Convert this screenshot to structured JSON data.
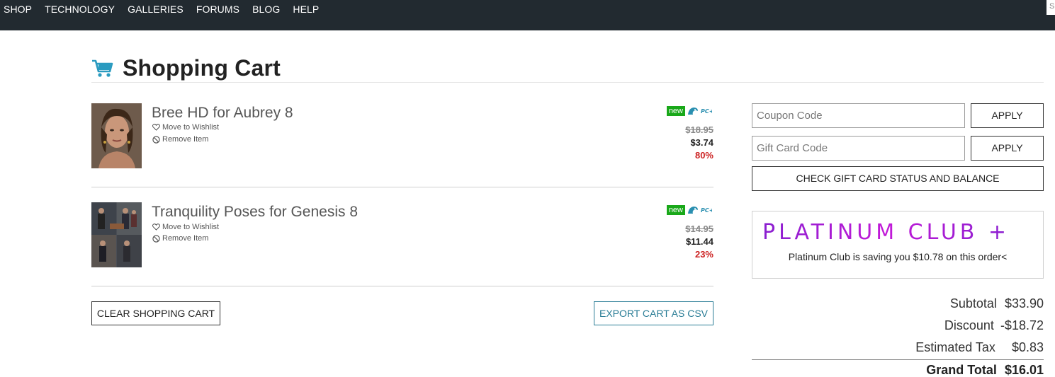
{
  "nav": {
    "items": [
      "SHOP",
      "TECHNOLOGY",
      "GALLERIES",
      "FORUMS",
      "BLOG",
      "HELP"
    ],
    "search_partial": "S"
  },
  "page": {
    "title": "Shopping Cart",
    "cart_icon": "shopping-cart-icon",
    "accent_color": "#2a9bc0"
  },
  "items": [
    {
      "name": "Bree HD for Aubrey 8",
      "wishlist_label": "Move to Wishlist",
      "remove_label": "Remove Item",
      "badge_new": "new",
      "badge_icons": [
        "daz-icon",
        "daz-plus-icon"
      ],
      "old_price": "$18.95",
      "new_price": "$3.74",
      "discount": "80%"
    },
    {
      "name": "Tranquility Poses for Genesis 8",
      "wishlist_label": "Move to Wishlist",
      "remove_label": "Remove Item",
      "badge_new": "new",
      "badge_icons": [
        "daz-icon",
        "daz-plus-icon"
      ],
      "old_price": "$14.95",
      "new_price": "$11.44",
      "discount": "23%"
    }
  ],
  "actions": {
    "clear_cart": "CLEAR SHOPPING CART",
    "export_csv": "EXPORT CART AS CSV"
  },
  "sidebar": {
    "coupon_placeholder": "Coupon Code",
    "gift_placeholder": "Gift Card Code",
    "apply_label": "APPLY",
    "check_gift_label": "CHECK GIFT CARD STATUS AND BALANCE",
    "platinum_logo": "PLATINUM CLUB +",
    "platinum_message": "Platinum Club is saving you $10.78 on this order<"
  },
  "totals": {
    "subtotal_label": "Subtotal",
    "subtotal_value": "$33.90",
    "discount_label": "Discount",
    "discount_value": "-$18.72",
    "tax_label": "Estimated Tax",
    "tax_value": "$0.83",
    "grand_label": "Grand Total",
    "grand_value": "$16.01"
  },
  "colors": {
    "nav_bg": "#222a30",
    "new_badge": "#19a819",
    "discount_red": "#cc2222",
    "export_teal": "#2a7d96",
    "platinum_purple": "#b01ad6"
  }
}
